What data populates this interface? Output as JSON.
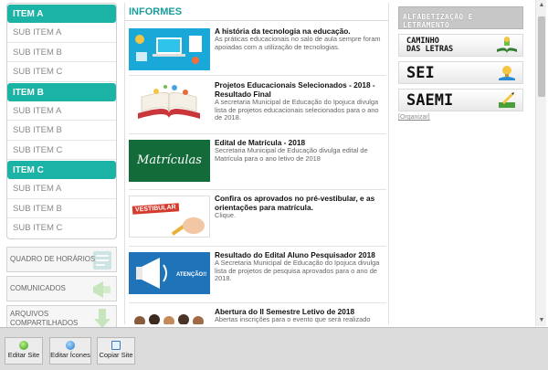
{
  "sidebar": {
    "menus": [
      {
        "label": "ITEM A",
        "subs": [
          "SUB ITEM A",
          "SUB ITEM B",
          "SUB ITEM C"
        ]
      },
      {
        "label": "ITEM B",
        "subs": [
          "SUB ITEM A",
          "SUB ITEM B",
          "SUB ITEM C"
        ]
      },
      {
        "label": "ITEM C",
        "subs": [
          "SUB ITEM A",
          "SUB ITEM B",
          "SUB ITEM C"
        ]
      }
    ],
    "boxes": {
      "quadro": "QUADRO DE HORÁRIOS",
      "comunicados": "COMUNICADOS",
      "arquivos_1": "ARQUIVOS",
      "arquivos_2": "COMPARTILHADOS"
    }
  },
  "feed": {
    "title": "INFORMES",
    "items": [
      {
        "title": "A história da tecnologia na educação.",
        "text": "As práticas educacionais no salo de aula sempre foram apoiadas com a utilização de tecnologias."
      },
      {
        "title": "Projetos Educacionais Selecionados - 2018 - Resultado Final",
        "text": "A secretaria Municipal de Educação do Ipojuca divulga lista de projetos educacionais selecionados para o ano de 2018."
      },
      {
        "title": "Edital de Matrícula - 2018",
        "text": "Secretaria Municipal de Educação divulga edital de Matrícula para o ano letivo de 2018",
        "thumb_text": "Matrículas"
      },
      {
        "title": "Confira os aprovados no pré-vestibular, e as orientações para matrícula.",
        "text": "Clique.",
        "thumb_text": "VESTIBULAR"
      },
      {
        "title": "Resultado do Edital Aluno Pesquisador 2018",
        "text": "A Secretaria Municipal de Educação do Ipojuca divulga lista de projetos de pesquisa aprovados para o ano de 2018.",
        "thumb_text": "ATENÇÃO!!"
      },
      {
        "title": "Abertura do II Semestre Letivo de 2018",
        "text": "Abertas inscrições para o evento que será realizado"
      }
    ]
  },
  "right": {
    "alfa": "ALFABETIZAÇÃO E LETRAMENTO",
    "caminho_1": "CAMINHO",
    "caminho_2": "DAS LETRAS",
    "sei": "SEI",
    "saemi": "SAEMI",
    "organizar": "[Organizar]"
  },
  "toolbar": {
    "editar_site": "Editar Site",
    "editar_icones": "Editar Ícones",
    "copiar_site": "Copiar Site"
  },
  "colors": {
    "accent": "#1ab3a6",
    "title": "#1a9d9a"
  }
}
